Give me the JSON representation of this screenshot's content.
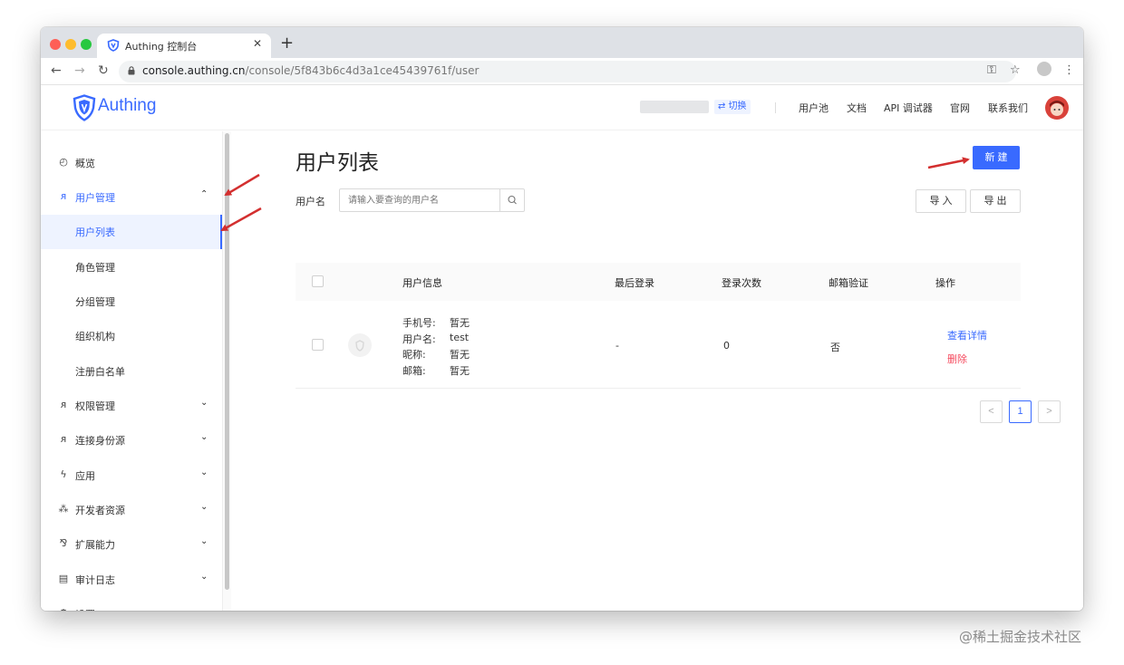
{
  "browser": {
    "tab_title": "Authing 控制台",
    "url_host": "console.authing.cn",
    "url_path": "/console/5f843b6c4d3a1ce45439761f/user"
  },
  "header": {
    "logo_text": "Authing",
    "switch_label": "⇄ 切换",
    "links": [
      "用户池",
      "文档",
      "API 调试器",
      "官网",
      "联系我们"
    ]
  },
  "sidebar": {
    "items": [
      {
        "label": "概览",
        "icon": "dashboard-icon"
      },
      {
        "label": "用户管理",
        "icon": "users-icon",
        "expanded": true
      },
      {
        "label": "用户列表",
        "sub": true,
        "active": true
      },
      {
        "label": "角色管理",
        "sub": true
      },
      {
        "label": "分组管理",
        "sub": true
      },
      {
        "label": "组织机构",
        "sub": true
      },
      {
        "label": "注册白名单",
        "sub": true
      },
      {
        "label": "权限管理",
        "icon": "permission-icon"
      },
      {
        "label": "连接身份源",
        "icon": "identity-icon"
      },
      {
        "label": "应用",
        "icon": "app-icon"
      },
      {
        "label": "开发者资源",
        "icon": "developer-icon"
      },
      {
        "label": "扩展能力",
        "icon": "extension-icon"
      },
      {
        "label": "审计日志",
        "icon": "audit-icon"
      },
      {
        "label": "设置",
        "icon": "settings-icon"
      }
    ]
  },
  "main": {
    "title": "用户列表",
    "new_button": "新 建",
    "filter_label": "用户名",
    "search_placeholder": "请输入要查询的用户名",
    "import_button": "导 入",
    "export_button": "导 出",
    "columns": [
      "用户信息",
      "最后登录",
      "登录次数",
      "邮箱验证",
      "操作"
    ],
    "rows": [
      {
        "info": [
          {
            "label": "手机号:",
            "value": "暂无"
          },
          {
            "label": "用户名:",
            "value": "test"
          },
          {
            "label": "昵称:",
            "value": "暂无"
          },
          {
            "label": "邮箱:",
            "value": "暂无"
          }
        ],
        "last_login": "-",
        "login_count": "0",
        "email_verified": "否",
        "action_view": "查看详情",
        "action_delete": "删除"
      }
    ],
    "pagination": {
      "prev": "<",
      "current": "1",
      "next": ">"
    }
  },
  "watermark": "@稀土掘金技术社区",
  "colors": {
    "accent": "#396aff",
    "danger": "#f5495d",
    "annotation_arrow": "#d32f2f"
  }
}
